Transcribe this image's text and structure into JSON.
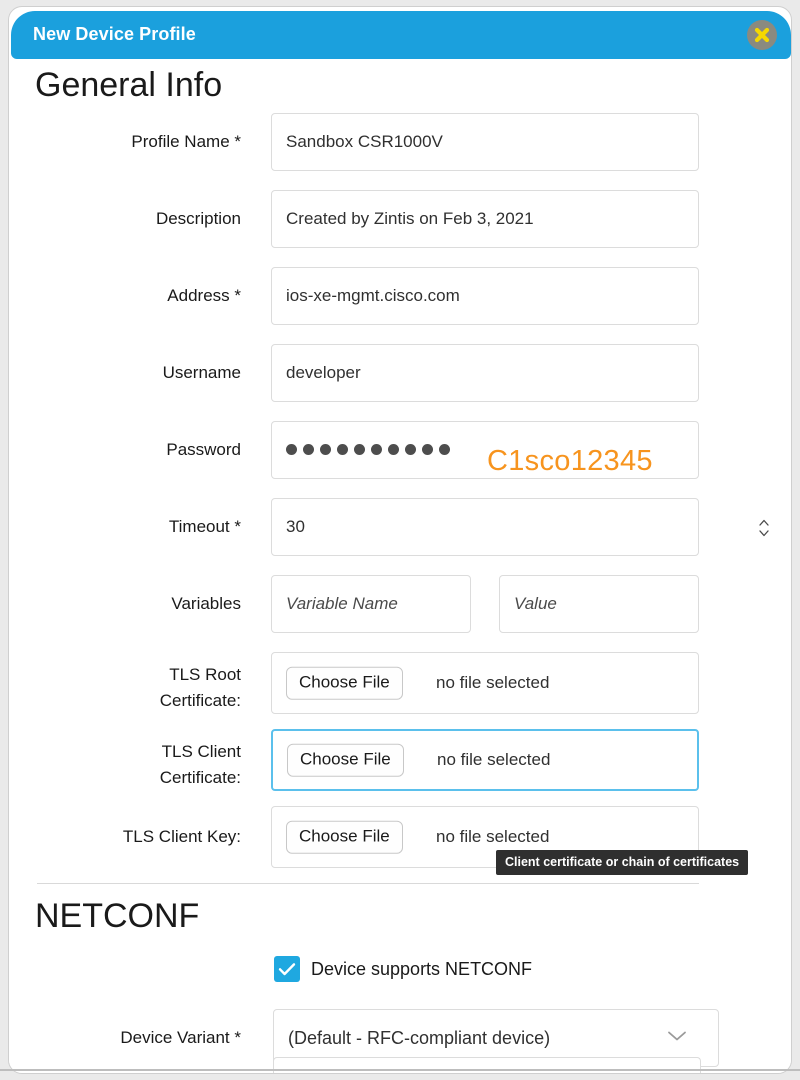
{
  "window": {
    "title": "New Device Profile",
    "close_icon": "close-x-icon",
    "header_color": "#1ba0dd",
    "close_button_color": "#8a8a80",
    "close_glyph_color": "#f5d800"
  },
  "sections": {
    "general": {
      "heading": "General Info"
    },
    "netconf": {
      "heading": "NETCONF"
    }
  },
  "fields": {
    "profile_name": {
      "label": "Profile Name *",
      "value": "Sandbox CSR1000V"
    },
    "description": {
      "label": "Description",
      "value": "Created by Zintis on Feb 3, 2021"
    },
    "address": {
      "label": "Address *",
      "value": "ios-xe-mgmt.cisco.com"
    },
    "username": {
      "label": "Username",
      "value": "developer"
    },
    "password": {
      "label": "Password",
      "masked_char_count": 10,
      "annotation": "C1sco12345",
      "annotation_color": "#f7941e"
    },
    "timeout": {
      "label": "Timeout *",
      "value": "30",
      "stepper_icon": "spinner-updown-icon"
    },
    "variables": {
      "label": "Variables",
      "name_placeholder": "Variable Name",
      "value_placeholder": "Value"
    },
    "tls_root_cert": {
      "label_line1": "TLS Root",
      "label_line2": "Certificate:",
      "button": "Choose File",
      "status": "no file selected"
    },
    "tls_client_cert": {
      "label_line1": "TLS Client",
      "label_line2": "Certificate:",
      "button": "Choose File",
      "status": "no file selected",
      "focused": true,
      "focus_color": "#5bc0ec"
    },
    "tls_client_key": {
      "label": "TLS Client Key:",
      "button": "Choose File",
      "status": "no file selected"
    },
    "netconf_supported": {
      "label": "Device supports NETCONF",
      "checked": true,
      "checkbox_color": "#1fa8e0"
    },
    "device_variant": {
      "label": "Device Variant *",
      "value": "(Default - RFC-compliant device)",
      "chevron_icon": "chevron-down-icon"
    }
  },
  "tooltip": {
    "text": "Client certificate or chain of certificates",
    "background": "#2f2f2f"
  }
}
